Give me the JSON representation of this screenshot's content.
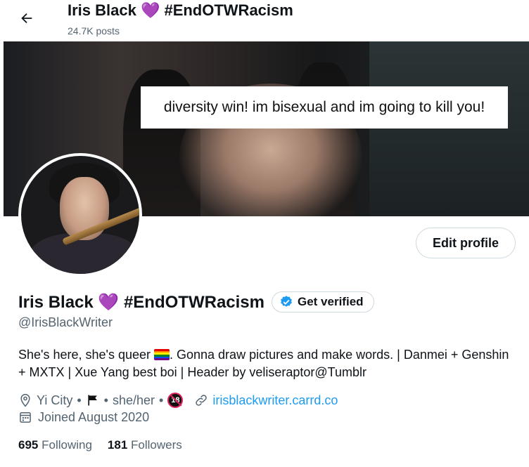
{
  "header": {
    "title": "Iris Black 💜 #EndOTWRacism",
    "posts_count": "24.7K posts"
  },
  "banner": {
    "caption": "diversity win! im bisexual and im going to kill you!"
  },
  "profile": {
    "name": "Iris Black 💜 #EndOTWRacism",
    "verify_label": "Get verified",
    "handle": "@IrisBlackWriter",
    "edit_label": "Edit profile",
    "bio_part1": "She's here, she's queer ",
    "bio_part2": ". Gonna draw pictures and make words. | Danmei + Genshin + MXTX | Xue Yang best boi | Header by veliseraptor@Tumblr",
    "location": "Yi City",
    "pronouns": "she/her",
    "age_badge": "18",
    "website": "irisblackwriter.carrd.co",
    "joined": "Joined August 2020",
    "following_count": "695",
    "following_label": "Following",
    "followers_count": "181",
    "followers_label": "Followers"
  },
  "icons": {
    "back": "arrow-left-icon",
    "location": "location-pin-icon",
    "flag": "black-flag-icon",
    "link": "link-icon",
    "calendar": "calendar-icon",
    "verified": "verified-badge-icon"
  },
  "colors": {
    "accent": "#1d9bf0",
    "secondary_text": "#536471",
    "verified_blue": "#1d9bf0"
  }
}
